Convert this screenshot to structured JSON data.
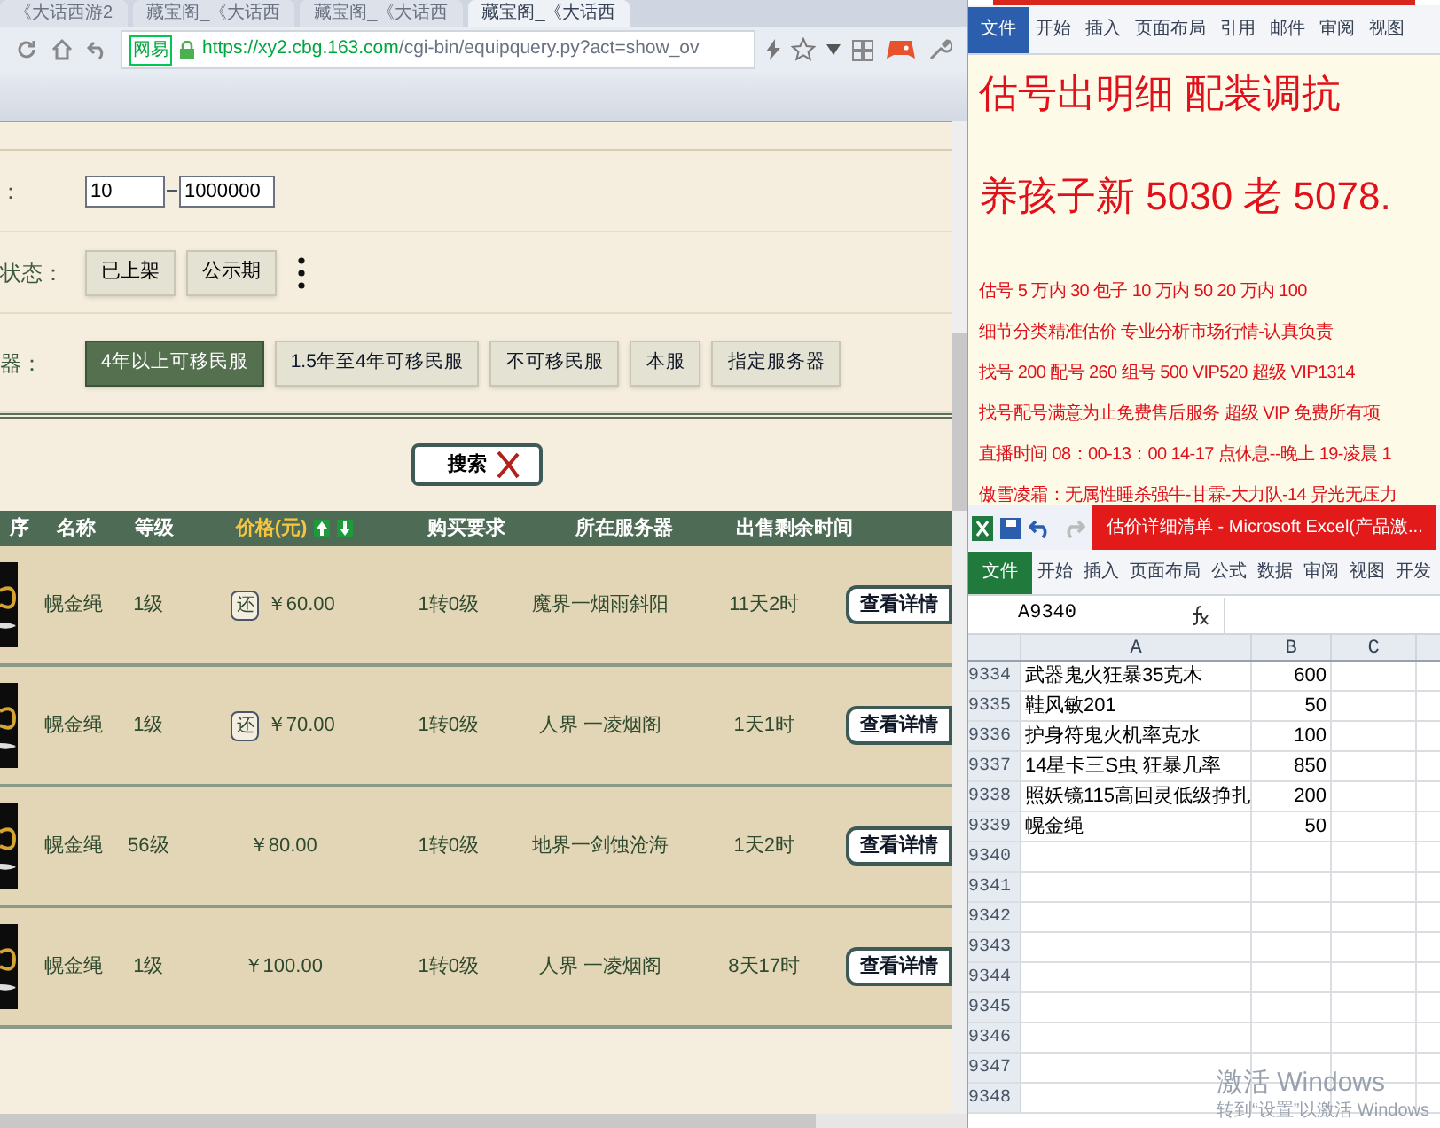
{
  "browser": {
    "tabs": [
      {
        "title": "《大话西游2",
        "selected": false
      },
      {
        "title": "藏宝阁_《大话西",
        "selected": false
      },
      {
        "title": "藏宝阁_《大话西",
        "selected": false
      },
      {
        "title": "藏宝阁_《大话西",
        "selected": true
      }
    ],
    "cert": "网易",
    "url_host": "https://xy2.cbg.163.com",
    "url_path": "/cgi-bin/equipquery.py?act=show_ov"
  },
  "filters": {
    "price_label": "：",
    "price_min": "10",
    "price_max": "1000000",
    "status_label": "状态：",
    "status_buttons": [
      "已上架",
      "公示期"
    ],
    "server_label": "器：",
    "server_buttons": [
      {
        "label": "4年以上可移民服",
        "selected": true
      },
      {
        "label": "1.5年至4年可移民服",
        "selected": false
      },
      {
        "label": "不可移民服",
        "selected": false
      },
      {
        "label": "本服",
        "selected": false
      },
      {
        "label": "指定服务器",
        "selected": false
      }
    ]
  },
  "search_button": "搜索",
  "table": {
    "columns": [
      "序",
      "名称",
      "等级",
      "价格(元)",
      "购买要求",
      "所在服务器",
      "出售剩余时间"
    ],
    "rows": [
      {
        "name": "幌金绳",
        "level": "1级",
        "badge": "还",
        "price": "￥60.00",
        "requirement": "1转0级",
        "server": "魔界一烟雨斜阳",
        "time": "11天2时",
        "action": "查看详情"
      },
      {
        "name": "幌金绳",
        "level": "1级",
        "badge": "还",
        "price": "￥70.00",
        "requirement": "1转0级",
        "server": "人界 一凌烟阁",
        "time": "1天1时",
        "action": "查看详情"
      },
      {
        "name": "幌金绳",
        "level": "56级",
        "price": "￥80.00",
        "requirement": "1转0级",
        "server": "地界一剑蚀沧海",
        "time": "1天2时",
        "action": "查看详情"
      },
      {
        "name": "幌金绳",
        "level": "1级",
        "price": "￥100.00",
        "requirement": "1转0级",
        "server": "人界 一凌烟阁",
        "time": "8天17时",
        "action": "查看详情"
      }
    ]
  },
  "word": {
    "tabs": [
      {
        "label": "文件",
        "selected": true
      },
      {
        "label": "开始",
        "selected": false
      },
      {
        "label": "插入",
        "selected": false
      },
      {
        "label": "页面布局",
        "selected": false
      },
      {
        "label": "引用",
        "selected": false
      },
      {
        "label": "邮件",
        "selected": false
      },
      {
        "label": "审阅",
        "selected": false
      },
      {
        "label": "视图",
        "selected": false
      }
    ],
    "lines": [
      {
        "kind": "heading",
        "text": "估号出明细 配装调抗"
      },
      {
        "kind": "heading",
        "text": "养孩子新 5030 老 5078."
      },
      {
        "kind": "body",
        "text": "估号 5 万内 30 包子  10 万内 50  20 万内 100"
      },
      {
        "kind": "body",
        "text": "细节分类精准估价  专业分析市场行情-认真负责"
      },
      {
        "kind": "body",
        "text": "找号 200   配号 260   组号 500 VIP520   超级 VIP1314"
      },
      {
        "kind": "body",
        "text": "找号配号满意为止免费售后服务   超级 VIP 免费所有项"
      },
      {
        "kind": "body",
        "text": "直播时间 08：00-13：00  14-17 点休息--晚上 19-凌晨 1"
      },
      {
        "kind": "body",
        "text": "傲雪凌霜：无属性睡杀强牛-甘霖-大力队-14 异光无压力"
      }
    ]
  },
  "excel": {
    "title": "估价详细清单 - Microsoft Excel(产品激...",
    "tabs": [
      {
        "label": "文件",
        "selected": true
      },
      {
        "label": "开始",
        "selected": false
      },
      {
        "label": "插入",
        "selected": false
      },
      {
        "label": "页面布局",
        "selected": false
      },
      {
        "label": "公式",
        "selected": false
      },
      {
        "label": "数据",
        "selected": false
      },
      {
        "label": "审阅",
        "selected": false
      },
      {
        "label": "视图",
        "selected": false
      },
      {
        "label": "开发",
        "selected": false
      }
    ],
    "name_box": "A9340",
    "columns": [
      "A",
      "B",
      "C"
    ],
    "rows": [
      {
        "number": "9334",
        "a": "武器鬼火狂暴35克木",
        "b": "600"
      },
      {
        "number": "9335",
        "a": "鞋风敏201",
        "b": "50"
      },
      {
        "number": "9336",
        "a": "护身符鬼火机率克水",
        "b": "100"
      },
      {
        "number": "9337",
        "a": "14星卡三S虫 狂暴几率",
        "b": "850"
      },
      {
        "number": "9338",
        "a": "照妖镜115高回灵低级挣扎",
        "b": "200"
      },
      {
        "number": "9339",
        "a": "幌金绳",
        "b": "50"
      },
      {
        "number": "9340"
      },
      {
        "number": "9341"
      },
      {
        "number": "9342"
      },
      {
        "number": "9343"
      },
      {
        "number": "9344"
      },
      {
        "number": "9345"
      },
      {
        "number": "9346"
      },
      {
        "number": "9347"
      },
      {
        "number": "9348"
      }
    ]
  },
  "activation": {
    "title": "激活 Windows",
    "subtitle": "转到“设置”以激活 Windows"
  }
}
